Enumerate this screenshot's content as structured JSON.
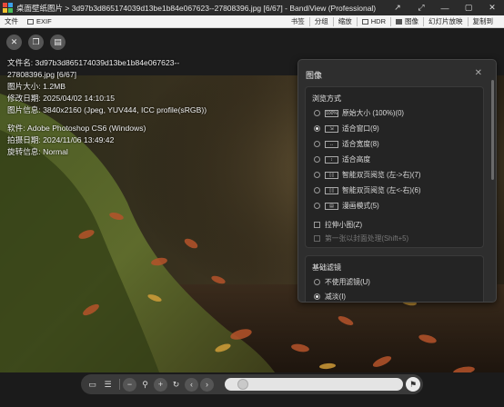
{
  "window": {
    "title": "桌面壁纸图片 > 3d97b3d865174039d13be1b84e067623--27808396.jpg [6/67] - BandiView (Professional)",
    "controls": [
      "↗",
      "⤢",
      "—",
      "▢",
      "✕"
    ]
  },
  "menubar": {
    "file": "文件",
    "exif": "EXIF",
    "bookmark": "书签",
    "split": "分组",
    "zoom": "缩放",
    "hdr": "HDR",
    "image": "图像",
    "slideshow": "幻灯片放映",
    "copy_to": "复制到"
  },
  "info": {
    "filename_label": "文件名: 3d97b3d865174039d13be1b84e067623--",
    "filename_cont": "27808396.jpg [6/67]",
    "size": "图片大小: 1.2MB",
    "modified": "修改日期: 2025/04/02 14:10:15",
    "imageinfo": "图片信息: 3840x2160 (Jpeg, YUV444, ICC profile(sRGB))",
    "software": "软件: Adobe Photoshop CS6 (Windows)",
    "taken": "拍摄日期: 2024/11/06 13:49:42",
    "rotation": "旋转信息: Normal"
  },
  "panel": {
    "title": "图像",
    "view_mode_title": "浏览方式",
    "options": [
      {
        "label": "原始大小 (100%)(0)",
        "icon": "100%",
        "selected": false
      },
      {
        "label": "适合窗口(9)",
        "icon": "⇲",
        "selected": true
      },
      {
        "label": "适合宽度(8)",
        "icon": "↔",
        "selected": false
      },
      {
        "label": "适合高度",
        "icon": "↕",
        "selected": false
      },
      {
        "label": "智能双页阅览 (左->右)(7)",
        "icon": "▯▯",
        "selected": false
      },
      {
        "label": "智能双页阅览 (左<-右)(6)",
        "icon": "▯▯",
        "selected": false
      },
      {
        "label": "漫画模式(5)",
        "icon": "▤",
        "selected": false
      }
    ],
    "stretch_small": "拉伸小图(Z)",
    "first_page_cover": "第一张以封面处理(Shift+5)",
    "filter_title": "基础滤镜",
    "filter_none": "不使用滤镜(U)",
    "filter_sharpen": "减淡(I)"
  },
  "colors": {
    "accent": "#2b2b2b",
    "panel_bg": "#2e2e2e"
  }
}
